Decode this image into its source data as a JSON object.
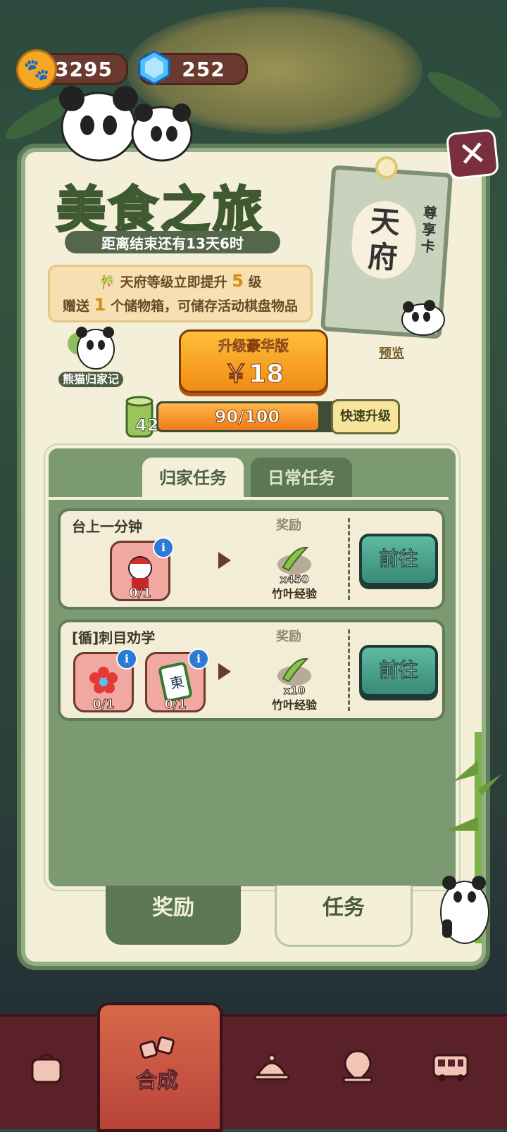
{
  "currency": {
    "paw": "3295",
    "gem": "252"
  },
  "event": {
    "title": "美食之旅",
    "countdown": "距离结束还有13天6时",
    "benefit_line1_pre": "天府等级立即提升",
    "benefit_line1_num": "5",
    "benefit_line1_post": "级",
    "benefit_line2_pre": "赠送",
    "benefit_line2_num": "1",
    "benefit_line2_post": "个储物箱，可储存活动棋盘物品",
    "card_main_1": "天",
    "card_main_2": "府",
    "card_side": "尊享卡",
    "preview_label": "预览",
    "book_label": "熊猫归家记",
    "upgrade_label": "升级豪华版",
    "upgrade_price": "￥18",
    "level": "42",
    "progress_text": "90/100",
    "progress_fraction": 0.9,
    "fast_upgrade": "快速升级"
  },
  "tabs": {
    "home": "归家任务",
    "daily": "日常任务"
  },
  "tasks": [
    {
      "title": "台上一分钟",
      "reward_header": "奖励",
      "items": [
        {
          "count": "0/1",
          "icon": "opera-character-icon"
        }
      ],
      "reward_qty": "x450",
      "reward_label": "竹叶经验",
      "go": "前往"
    },
    {
      "title": "[循]刺目劝学",
      "reward_header": "奖励",
      "items": [
        {
          "count": "0/1",
          "icon": "flower-crown-icon"
        },
        {
          "count": "0/1",
          "icon": "mahjong-tile-icon"
        }
      ],
      "reward_qty": "x10",
      "reward_label": "竹叶经验",
      "go": "前往"
    }
  ],
  "bottom_tabs": {
    "reward": "奖励",
    "task": "任务"
  },
  "nav": {
    "merge": "合成"
  },
  "colors": {
    "panel": "#f4efd8",
    "green": "#7b9a71",
    "orange": "#f08b14",
    "teal": "#3a8a76",
    "nav": "#5a2228"
  }
}
